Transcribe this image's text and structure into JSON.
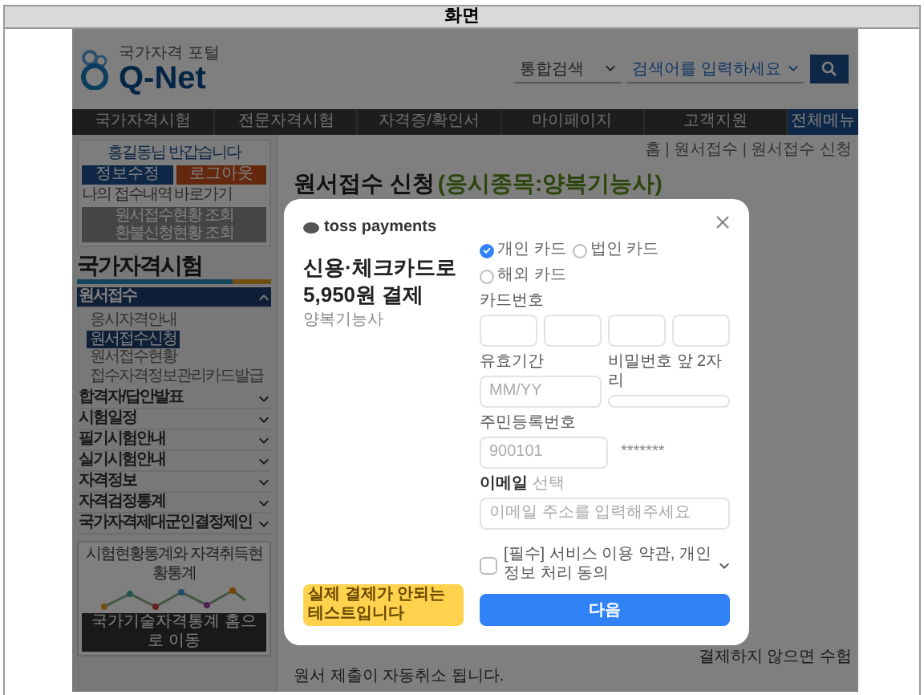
{
  "header": {
    "title": "화면"
  },
  "site": {
    "logo": {
      "tagline": "국가자격 포털",
      "name": "Q-Net"
    },
    "search": {
      "scope": "통합검색",
      "placeholder": "검색어를 입력하세요"
    },
    "nav": [
      {
        "label": "국가자격시험"
      },
      {
        "label": "전문자격시험"
      },
      {
        "label": "자격증/확인서"
      },
      {
        "label": "마이페이지"
      },
      {
        "label": "고객지원"
      }
    ],
    "all_menu": "전체메뉴",
    "sidebar": {
      "greeting": "홍길동님 반갑습니다",
      "buttons": [
        {
          "label": "정보수정",
          "kind": "primary"
        },
        {
          "label": "로그아웃",
          "kind": "danger"
        }
      ],
      "link": "나의 접수내역 바로가기",
      "notice": [
        "원서접수현황 조회",
        "환불신청현황 조회"
      ],
      "section_title": "국가자격시험",
      "menu": [
        {
          "label": "원서접수",
          "expanded": true,
          "children": [
            {
              "label": "응시자격안내",
              "selected": false
            },
            {
              "label": "원서접수신청",
              "selected": true
            },
            {
              "label": "원서접수현황",
              "selected": false
            },
            {
              "label": "접수자격정보관리카드발급",
              "selected": false
            }
          ]
        },
        {
          "label": "합격자/답안발표",
          "expanded": false
        },
        {
          "label": "시험일정",
          "expanded": false
        },
        {
          "label": "필기시험안내",
          "expanded": false
        },
        {
          "label": "실기시험안내",
          "expanded": false
        },
        {
          "label": "자격정보",
          "expanded": false
        },
        {
          "label": "자격검정통계",
          "expanded": false
        },
        {
          "label": "국가자격제대군인결정제인",
          "expanded": false
        }
      ],
      "banner": {
        "caption": "시험현황통계와 자격취득현황통계",
        "button": "국가기술자격통계 홈으로 이동"
      }
    },
    "main": {
      "breadcrumb": "홈 | 원서접수 | 원서접수 신청",
      "title": "원서접수 신청",
      "subtitle": "(응시종목:양복기능사)",
      "notices": [
        "결제하지 않으면 수험",
        "원서 제출이 자동취소 됩니다."
      ]
    }
  },
  "modal": {
    "brand": "toss payments",
    "heading": [
      "신용·체크카드로",
      "5,950원 결제"
    ],
    "item": "양복기능사",
    "test_badge": "실제 결제가 안되는 테스트입니다",
    "card_types": [
      {
        "label": "개인 카드",
        "selected": true
      },
      {
        "label": "법인 카드",
        "selected": false
      },
      {
        "label": "해외 카드",
        "selected": false
      }
    ],
    "card_number": {
      "label": "카드번호"
    },
    "expiry": {
      "label": "유효기간",
      "placeholder": "MM/YY"
    },
    "pin": {
      "label": "비밀번호 앞 2자리"
    },
    "id_number": {
      "label": "주민등록번호",
      "placeholder": "900101",
      "masked": "*******"
    },
    "email": {
      "label": "이메일",
      "optional": "선택",
      "placeholder": "이메일 주소를 입력해주세요"
    },
    "agreement": {
      "label": "[필수] 서비스 이용 약관, 개인정보 처리 동의",
      "checked": false
    },
    "submit": "다음"
  }
}
